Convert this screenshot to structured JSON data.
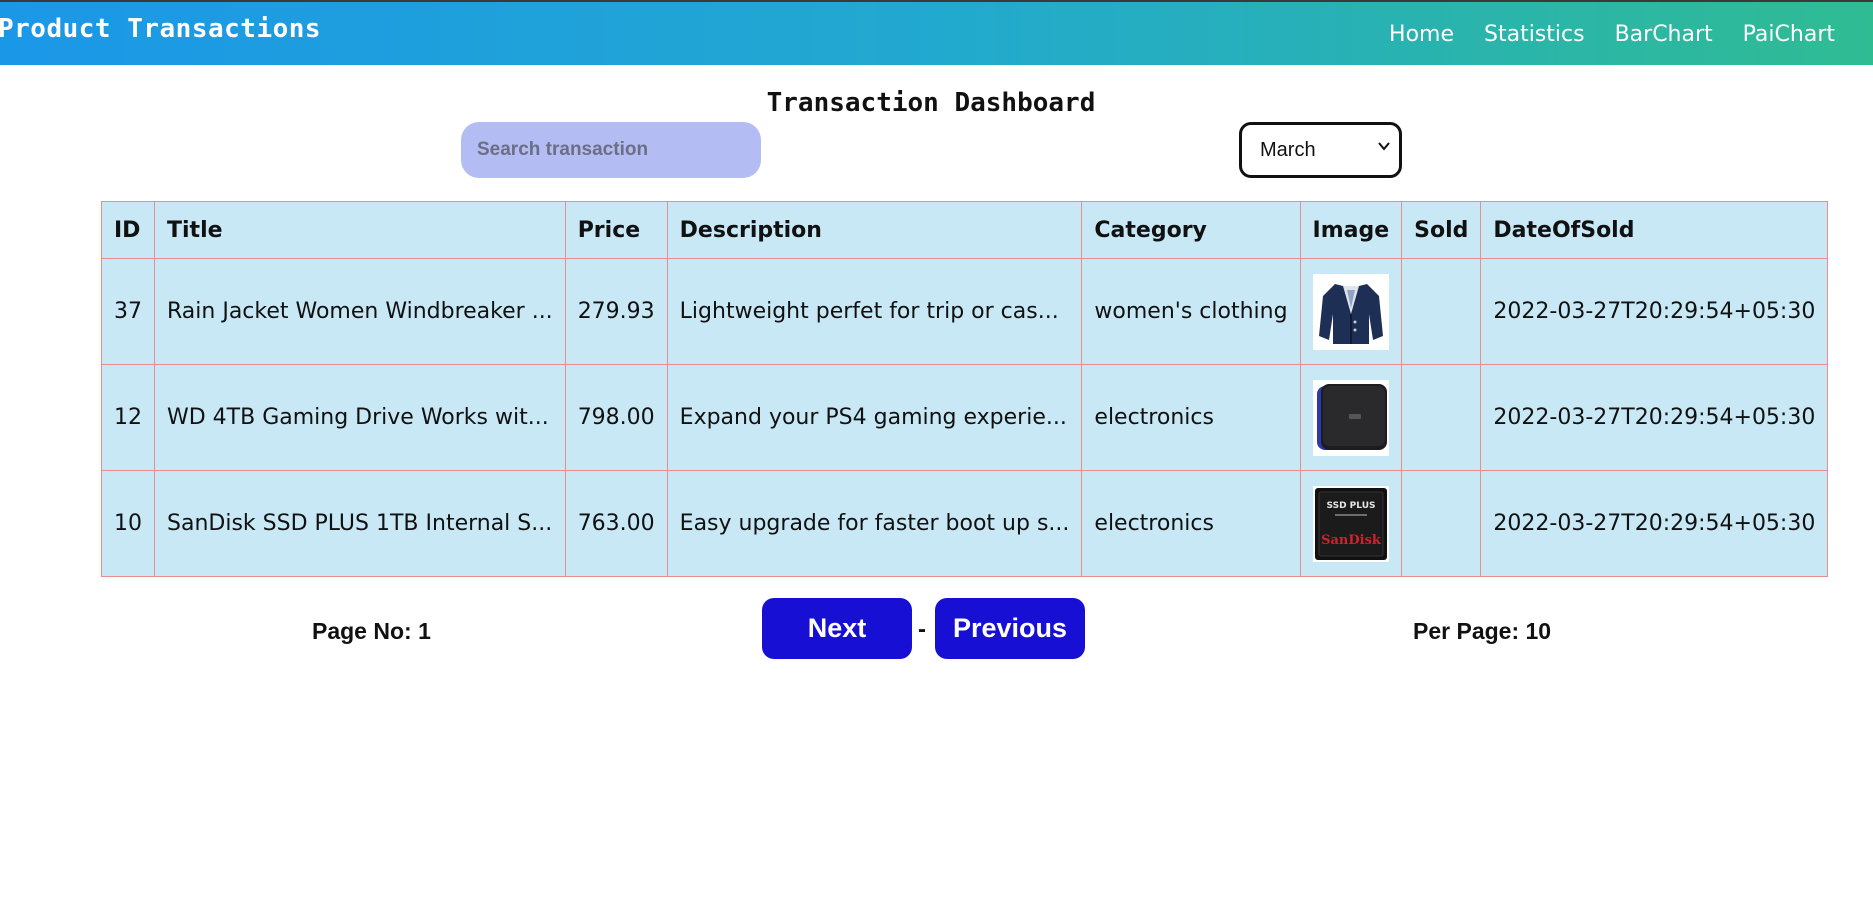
{
  "navbar": {
    "brand": "Product Transactions",
    "links": [
      {
        "label": "Home"
      },
      {
        "label": "Statistics"
      },
      {
        "label": "BarChart"
      },
      {
        "label": "PaiChart"
      }
    ]
  },
  "dashboard": {
    "title": "Transaction Dashboard"
  },
  "search": {
    "placeholder": "Search transaction",
    "value": ""
  },
  "month_select": {
    "selected": "March"
  },
  "table": {
    "headers": [
      "ID",
      "Title",
      "Price",
      "Description",
      "Category",
      "Image",
      "Sold",
      "DateOfSold"
    ],
    "rows": [
      {
        "id": "37",
        "title": "Rain Jacket Women Windbreaker ...",
        "price": "279.93",
        "description": "Lightweight perfet for trip or cas...",
        "category": "women's clothing",
        "image_icon": "jacket-image",
        "sold": "",
        "date": "2022-03-27T20:29:54+05:30"
      },
      {
        "id": "12",
        "title": "WD 4TB Gaming Drive Works wit...",
        "price": "798.00",
        "description": "Expand your PS4 gaming experie...",
        "category": "electronics",
        "image_icon": "hard-drive-image",
        "sold": "",
        "date": "2022-03-27T20:29:54+05:30"
      },
      {
        "id": "10",
        "title": "SanDisk SSD PLUS 1TB Internal S...",
        "price": "763.00",
        "description": "Easy upgrade for faster boot up s...",
        "category": "electronics",
        "image_icon": "ssd-image",
        "sold": "",
        "date": "2022-03-27T20:29:54+05:30"
      }
    ]
  },
  "pagination": {
    "page_label": "Page No: 1",
    "next_label": "Next",
    "separator": "-",
    "previous_label": "Previous",
    "per_page_label": "Per Page: 10"
  },
  "ssd_logo": {
    "line1": "SSD PLUS",
    "brand": "SanDisk"
  },
  "colors": {
    "nav_gradient_start": "#1b97e8",
    "nav_gradient_end": "#2fbc93",
    "table_bg": "#c8e8f6",
    "table_border": "#e88e8e",
    "search_bg": "#b3bdf3",
    "button_bg": "#170fd3"
  }
}
